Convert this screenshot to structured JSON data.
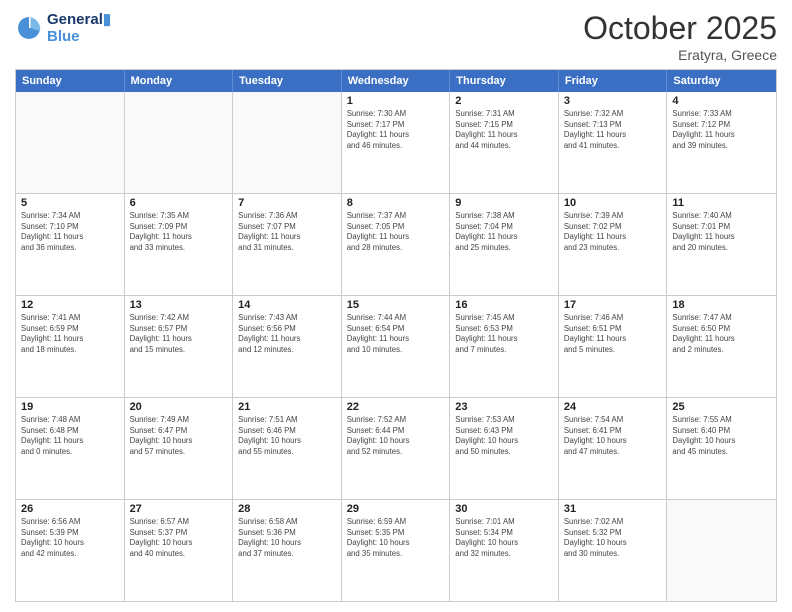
{
  "logo": {
    "line1": "General",
    "line2": "Blue"
  },
  "title": "October 2025",
  "location": "Eratyra, Greece",
  "days_header": [
    "Sunday",
    "Monday",
    "Tuesday",
    "Wednesday",
    "Thursday",
    "Friday",
    "Saturday"
  ],
  "weeks": [
    [
      {
        "day": "",
        "info": ""
      },
      {
        "day": "",
        "info": ""
      },
      {
        "day": "",
        "info": ""
      },
      {
        "day": "1",
        "info": "Sunrise: 7:30 AM\nSunset: 7:17 PM\nDaylight: 11 hours\nand 46 minutes."
      },
      {
        "day": "2",
        "info": "Sunrise: 7:31 AM\nSunset: 7:15 PM\nDaylight: 11 hours\nand 44 minutes."
      },
      {
        "day": "3",
        "info": "Sunrise: 7:32 AM\nSunset: 7:13 PM\nDaylight: 11 hours\nand 41 minutes."
      },
      {
        "day": "4",
        "info": "Sunrise: 7:33 AM\nSunset: 7:12 PM\nDaylight: 11 hours\nand 39 minutes."
      }
    ],
    [
      {
        "day": "5",
        "info": "Sunrise: 7:34 AM\nSunset: 7:10 PM\nDaylight: 11 hours\nand 36 minutes."
      },
      {
        "day": "6",
        "info": "Sunrise: 7:35 AM\nSunset: 7:09 PM\nDaylight: 11 hours\nand 33 minutes."
      },
      {
        "day": "7",
        "info": "Sunrise: 7:36 AM\nSunset: 7:07 PM\nDaylight: 11 hours\nand 31 minutes."
      },
      {
        "day": "8",
        "info": "Sunrise: 7:37 AM\nSunset: 7:05 PM\nDaylight: 11 hours\nand 28 minutes."
      },
      {
        "day": "9",
        "info": "Sunrise: 7:38 AM\nSunset: 7:04 PM\nDaylight: 11 hours\nand 25 minutes."
      },
      {
        "day": "10",
        "info": "Sunrise: 7:39 AM\nSunset: 7:02 PM\nDaylight: 11 hours\nand 23 minutes."
      },
      {
        "day": "11",
        "info": "Sunrise: 7:40 AM\nSunset: 7:01 PM\nDaylight: 11 hours\nand 20 minutes."
      }
    ],
    [
      {
        "day": "12",
        "info": "Sunrise: 7:41 AM\nSunset: 6:59 PM\nDaylight: 11 hours\nand 18 minutes."
      },
      {
        "day": "13",
        "info": "Sunrise: 7:42 AM\nSunset: 6:57 PM\nDaylight: 11 hours\nand 15 minutes."
      },
      {
        "day": "14",
        "info": "Sunrise: 7:43 AM\nSunset: 6:56 PM\nDaylight: 11 hours\nand 12 minutes."
      },
      {
        "day": "15",
        "info": "Sunrise: 7:44 AM\nSunset: 6:54 PM\nDaylight: 11 hours\nand 10 minutes."
      },
      {
        "day": "16",
        "info": "Sunrise: 7:45 AM\nSunset: 6:53 PM\nDaylight: 11 hours\nand 7 minutes."
      },
      {
        "day": "17",
        "info": "Sunrise: 7:46 AM\nSunset: 6:51 PM\nDaylight: 11 hours\nand 5 minutes."
      },
      {
        "day": "18",
        "info": "Sunrise: 7:47 AM\nSunset: 6:50 PM\nDaylight: 11 hours\nand 2 minutes."
      }
    ],
    [
      {
        "day": "19",
        "info": "Sunrise: 7:48 AM\nSunset: 6:48 PM\nDaylight: 11 hours\nand 0 minutes."
      },
      {
        "day": "20",
        "info": "Sunrise: 7:49 AM\nSunset: 6:47 PM\nDaylight: 10 hours\nand 57 minutes."
      },
      {
        "day": "21",
        "info": "Sunrise: 7:51 AM\nSunset: 6:46 PM\nDaylight: 10 hours\nand 55 minutes."
      },
      {
        "day": "22",
        "info": "Sunrise: 7:52 AM\nSunset: 6:44 PM\nDaylight: 10 hours\nand 52 minutes."
      },
      {
        "day": "23",
        "info": "Sunrise: 7:53 AM\nSunset: 6:43 PM\nDaylight: 10 hours\nand 50 minutes."
      },
      {
        "day": "24",
        "info": "Sunrise: 7:54 AM\nSunset: 6:41 PM\nDaylight: 10 hours\nand 47 minutes."
      },
      {
        "day": "25",
        "info": "Sunrise: 7:55 AM\nSunset: 6:40 PM\nDaylight: 10 hours\nand 45 minutes."
      }
    ],
    [
      {
        "day": "26",
        "info": "Sunrise: 6:56 AM\nSunset: 5:39 PM\nDaylight: 10 hours\nand 42 minutes."
      },
      {
        "day": "27",
        "info": "Sunrise: 6:57 AM\nSunset: 5:37 PM\nDaylight: 10 hours\nand 40 minutes."
      },
      {
        "day": "28",
        "info": "Sunrise: 6:58 AM\nSunset: 5:36 PM\nDaylight: 10 hours\nand 37 minutes."
      },
      {
        "day": "29",
        "info": "Sunrise: 6:59 AM\nSunset: 5:35 PM\nDaylight: 10 hours\nand 35 minutes."
      },
      {
        "day": "30",
        "info": "Sunrise: 7:01 AM\nSunset: 5:34 PM\nDaylight: 10 hours\nand 32 minutes."
      },
      {
        "day": "31",
        "info": "Sunrise: 7:02 AM\nSunset: 5:32 PM\nDaylight: 10 hours\nand 30 minutes."
      },
      {
        "day": "",
        "info": ""
      }
    ]
  ]
}
